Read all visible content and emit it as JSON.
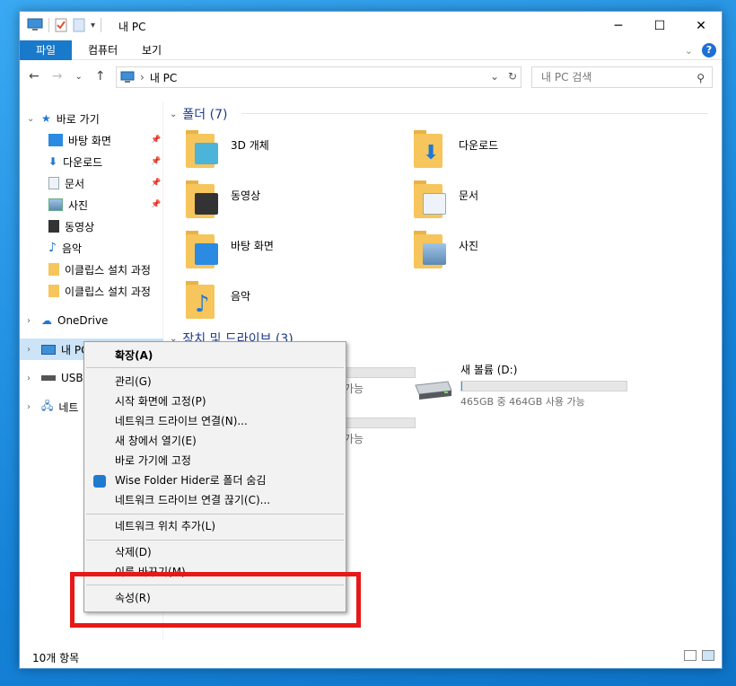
{
  "window": {
    "title": "내 PC",
    "controls": {
      "minimize": "─",
      "maximize": "☐",
      "close": "✕"
    }
  },
  "ribbon": {
    "tabs": [
      "파일",
      "컴퓨터",
      "보기"
    ],
    "help": "?"
  },
  "address": {
    "path": "내 PC",
    "search_placeholder": "내 PC 검색"
  },
  "sidebar": {
    "quick_access": "바로 가기",
    "items": [
      "바탕 화면",
      "다운로드",
      "문서",
      "사진",
      "동영상",
      "음악",
      "이클립스 설치 과정",
      "이클립스 설치 과정"
    ],
    "onedrive": "OneDrive",
    "mypc": "내 PC",
    "usb": "USB3",
    "network": "네트"
  },
  "main": {
    "folders_header": "폴더 (7)",
    "folders": [
      "3D 개체",
      "다운로드",
      "동영상",
      "문서",
      "바탕 화면",
      "사진",
      "음악"
    ],
    "drives_header": "장치 및 드라이브 (3)",
    "drive_partial_1": "가능",
    "drive_partial_2": "가능",
    "drive_d": {
      "name": "새 볼륨 (D:)",
      "free": "465GB 중 464GB 사용 가능",
      "used_fraction": 0.002
    }
  },
  "status": {
    "count": "10개 항목"
  },
  "context_menu": {
    "items": [
      "확장(A)",
      "관리(G)",
      "시작 화면에 고정(P)",
      "네트워크 드라이브 연결(N)...",
      "새 창에서 열기(E)",
      "바로 가기에 고정",
      "Wise Folder Hider로 폴더 숨김",
      "네트워크 드라이브 연결 끊기(C)...",
      "네트워크 위치 추가(L)",
      "삭제(D)",
      "이름 바꾸기(M)",
      "속성(R)"
    ]
  },
  "colors": {
    "accent": "#1979ca",
    "highlight_box": "#e81818",
    "folder": "#f6c55c"
  }
}
